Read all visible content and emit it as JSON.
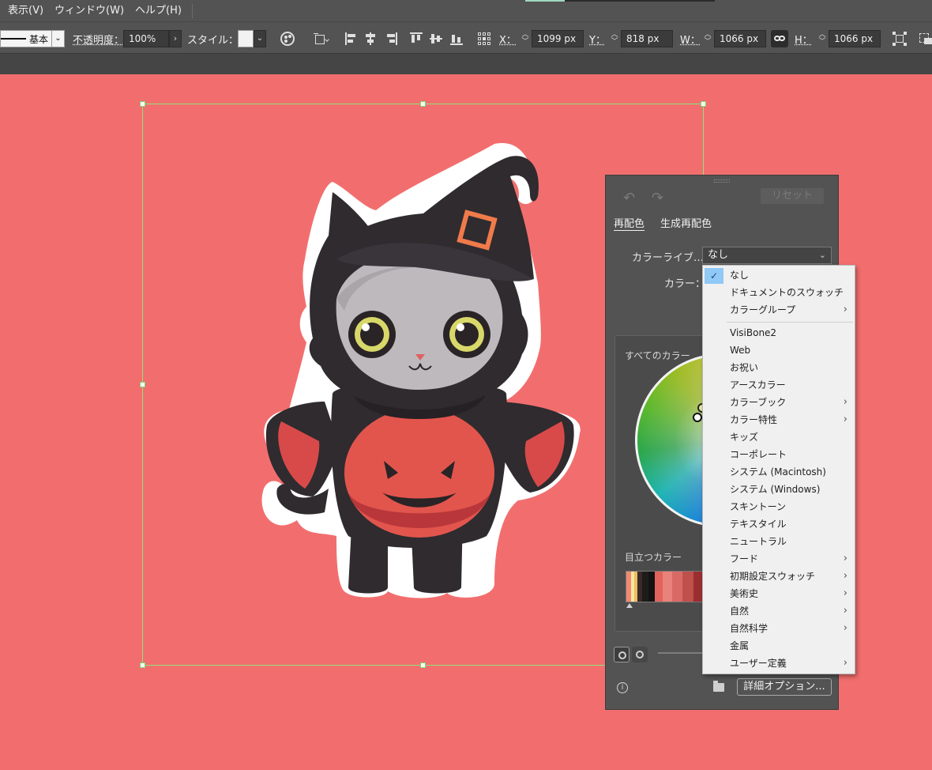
{
  "menubar": {
    "items": [
      "表示(V)",
      "ウィンドウ(W)",
      "ヘルプ(H)"
    ]
  },
  "controlbar": {
    "stroke_style": "基本",
    "opacity_label": "不透明度：",
    "opacity_value": "100%",
    "style_label": "スタイル：",
    "x_label": "X：",
    "x_value": "1099 px",
    "y_label": "Y：",
    "y_value": "818 px",
    "w_label": "W：",
    "w_value": "1066 px",
    "h_label": "H：",
    "h_value": "1066 px"
  },
  "panel": {
    "reset_label": "リセット",
    "tabs": [
      {
        "label": "再配色",
        "active": true
      },
      {
        "label": "生成再配色",
        "active": false
      }
    ],
    "color_library_label": "カラーライブ…",
    "color_library_value": "なし",
    "colors_label": "カラー：",
    "all_colors_label": "すべてのカラー",
    "prominent_colors_label": "目立つカラー",
    "prominent_colors": [
      "#f08a70",
      "#f4e6a0",
      "#e8c060",
      "#3a2a2a",
      "#1f1b1b",
      "#141212",
      "#e2625c",
      "#e8827a",
      "#d86a66",
      "#c0504e",
      "#9a2e30",
      "#b05852",
      "#6a5a5a"
    ],
    "advanced_button": "詳細オプション..."
  },
  "dropdown": {
    "items": [
      {
        "label": "なし",
        "checked": true,
        "submenu": false
      },
      {
        "label": "ドキュメントのスウォッチ",
        "checked": false,
        "submenu": false
      },
      {
        "label": "カラーグループ",
        "checked": false,
        "submenu": true
      },
      {
        "label": "VisiBone2",
        "checked": false,
        "submenu": false
      },
      {
        "label": "Web",
        "checked": false,
        "submenu": false
      },
      {
        "label": "お祝い",
        "checked": false,
        "submenu": false
      },
      {
        "label": "アースカラー",
        "checked": false,
        "submenu": false
      },
      {
        "label": "カラーブック",
        "checked": false,
        "submenu": true
      },
      {
        "label": "カラー特性",
        "checked": false,
        "submenu": true
      },
      {
        "label": "キッズ",
        "checked": false,
        "submenu": false
      },
      {
        "label": "コーポレート",
        "checked": false,
        "submenu": false
      },
      {
        "label": "システム (Macintosh)",
        "checked": false,
        "submenu": false
      },
      {
        "label": "システム (Windows)",
        "checked": false,
        "submenu": false
      },
      {
        "label": "スキントーン",
        "checked": false,
        "submenu": false
      },
      {
        "label": "テキスタイル",
        "checked": false,
        "submenu": false
      },
      {
        "label": "ニュートラル",
        "checked": false,
        "submenu": false
      },
      {
        "label": "フード",
        "checked": false,
        "submenu": true
      },
      {
        "label": "初期設定スウォッチ",
        "checked": false,
        "submenu": true
      },
      {
        "label": "美術史",
        "checked": false,
        "submenu": true
      },
      {
        "label": "自然",
        "checked": false,
        "submenu": true
      },
      {
        "label": "自然科学",
        "checked": false,
        "submenu": true
      },
      {
        "label": "金属",
        "checked": false,
        "submenu": false
      },
      {
        "label": "ユーザー定義",
        "checked": false,
        "submenu": true
      }
    ]
  },
  "colors": {
    "canvas_bg": "#f26e6e",
    "ui_bg": "#535353",
    "selection": "#8fe37c",
    "menu_check": "#90c8f6"
  }
}
